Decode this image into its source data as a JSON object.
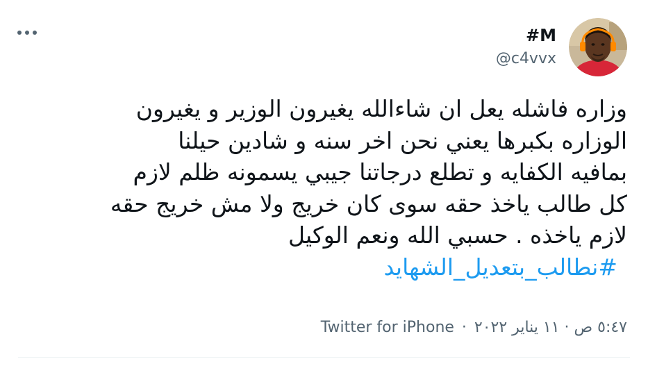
{
  "tweet": {
    "author": {
      "display_name": "#M",
      "handle": "@c4vvx",
      "avatar_icon": "profile-photo"
    },
    "more_icon": "ellipsis-icon",
    "body_lines": [
      "وزاره فاشله يعل ان شاءالله يغيرون الوزير و يغيرون",
      "الوزاره بكبرها يعني نحن اخر سنه و شادين حيلنا",
      "بمافيه الكفايه و تطلع درجاتنا جيبي يسمونه ظلم لازم",
      "كل طالب ياخذ حقه سوى كان خريج ولا مش خريج حقه",
      "لازم ياخذه  . حسبي الله ونعم الوكيل"
    ],
    "hashtag": "#نطالب_بتعديل_الشهايد",
    "timestamp": "٥:٤٧ ص · ١١ يناير ٢٠٢٢",
    "separator": "·",
    "source": "Twitter for iPhone",
    "colors": {
      "text": "#0f1419",
      "secondary": "#536471",
      "link": "#1d9bf0"
    }
  }
}
